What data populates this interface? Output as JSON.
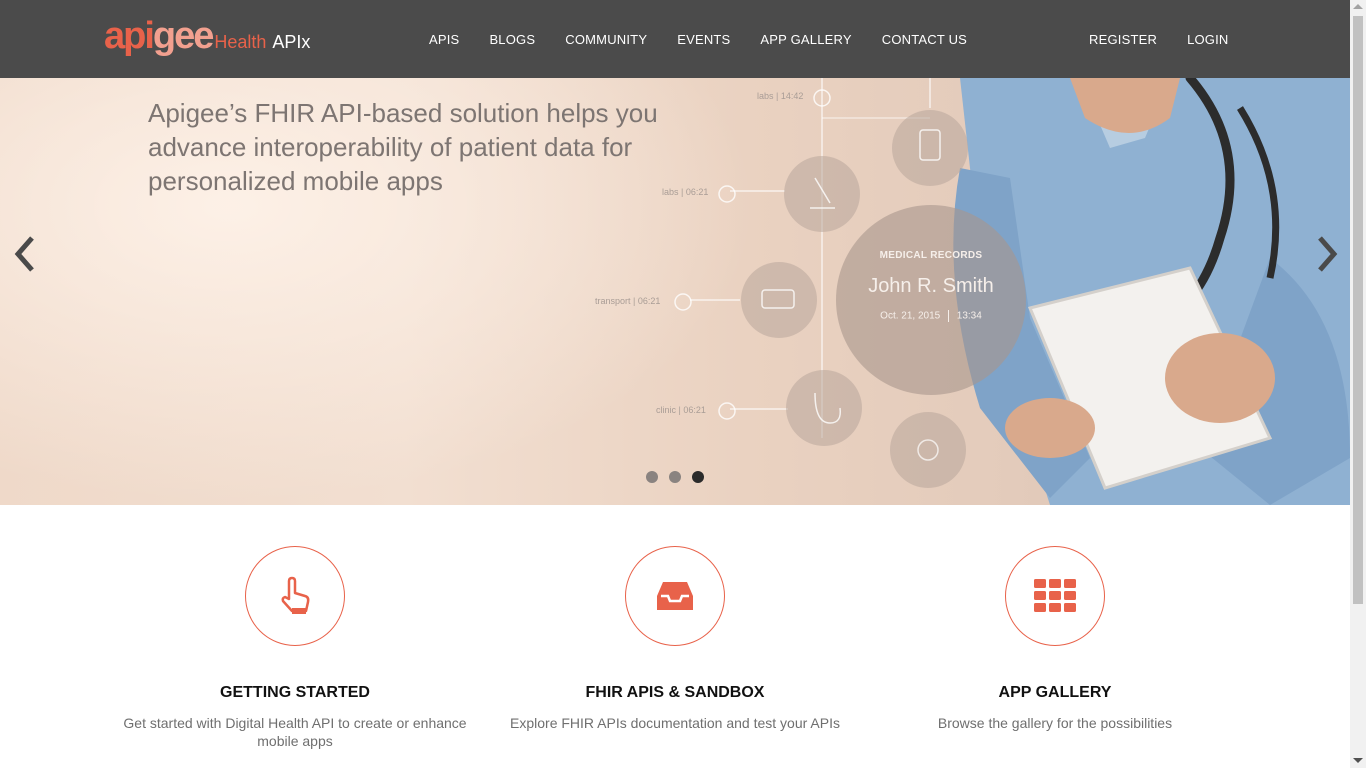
{
  "header": {
    "logo": {
      "brand_part1": "api",
      "brand_part2": "gee",
      "product": "Health",
      "suffix": "APIx"
    },
    "nav": [
      "APIS",
      "BLOGS",
      "COMMUNITY",
      "EVENTS",
      "APP GALLERY",
      "CONTACT US"
    ],
    "auth": {
      "register": "REGISTER",
      "login": "LOGIN"
    }
  },
  "hero": {
    "headline": "Apigee’s FHIR API-based solution helps you advance interoperability of patient data for personalized mobile apps",
    "timeline": [
      {
        "label": "labs | 14:42"
      },
      {
        "label": "labs | 06:21"
      },
      {
        "label": "transport | 06:21"
      },
      {
        "label": "clinic | 06:21"
      }
    ],
    "record": {
      "title": "MEDICAL RECORDS",
      "name": "John R. Smith",
      "date": "Oct. 21, 2015",
      "time": "13:34"
    },
    "slide_count": 3,
    "active_slide": 3
  },
  "features": [
    {
      "icon": "pointer-hand-icon",
      "title": "GETTING STARTED",
      "desc": "Get started with Digital Health API to create or enhance mobile apps"
    },
    {
      "icon": "inbox-tray-icon",
      "title": "FHIR APIs & SANDBOX",
      "desc": "Explore FHIR APIs documentation and test your APIs"
    },
    {
      "icon": "grid-apps-icon",
      "title": "APP GALLERY",
      "desc": "Browse the gallery for the possibilities"
    }
  ],
  "colors": {
    "accent": "#e8624a",
    "header_bg": "#4b4b4b"
  }
}
